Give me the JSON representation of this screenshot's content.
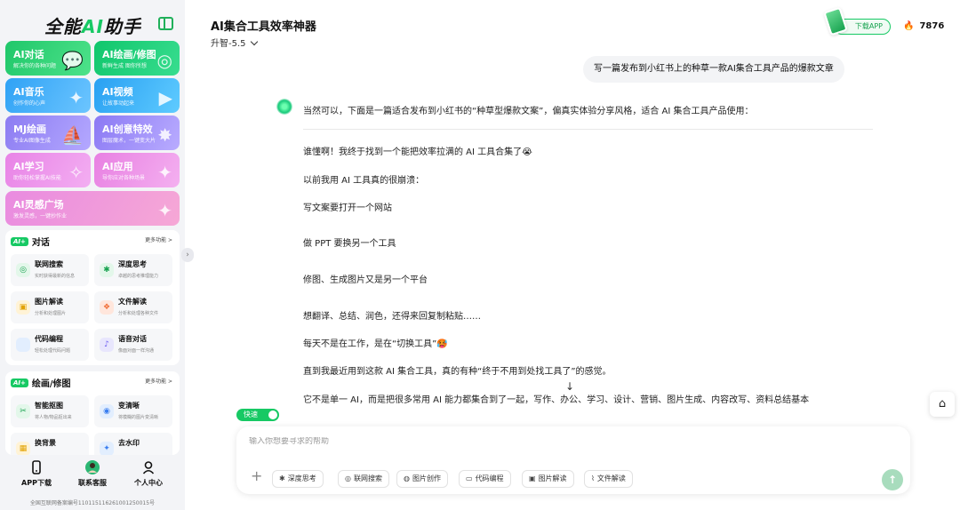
{
  "sidebar": {
    "logo_text_a": "全能",
    "logo_text_ai": "AI",
    "logo_text_b": "助手",
    "cards": [
      {
        "title": "AI对话",
        "sub": "解决你的各种问题",
        "color": "#1fc76a",
        "color2": "#4ee28a",
        "icon": "chat-icon"
      },
      {
        "title": "AI绘画/修图",
        "sub": "新鲜生成 图你所想",
        "color": "#10c66c",
        "color2": "#38dd8f",
        "icon": "paint-icon"
      },
      {
        "title": "AI音乐",
        "sub": "创作你的心声",
        "color": "#2fa2f5",
        "color2": "#6cc5ff",
        "icon": "music-icon"
      },
      {
        "title": "AI视频",
        "sub": "让故事动起来",
        "color": "#29a0f2",
        "color2": "#5fcbff",
        "icon": "video-icon"
      },
      {
        "title": "MJ绘画",
        "sub": "专业AI图像生成",
        "color": "#8c7cf2",
        "color2": "#b4a8ff",
        "icon": "sail-icon"
      },
      {
        "title": "AI创意特效",
        "sub": "图层魔术，一键变大片",
        "color": "#8b79f4",
        "color2": "#b9acff",
        "icon": "wand-icon"
      },
      {
        "title": "AI学习",
        "sub": "助你轻松掌握AI技能",
        "color": "#e883e6",
        "color2": "#f3aef2",
        "icon": "star-icon"
      },
      {
        "title": "AI应用",
        "sub": "导你应对各种场景",
        "color": "#e880e2",
        "color2": "#f4b0f0",
        "icon": "grid-icon"
      },
      {
        "title": "AI灵感广场",
        "sub": "激发灵感，一键抄作业",
        "color": "#e98be0",
        "color2": "#f6a8d6",
        "icon": "sparkle-icon"
      }
    ],
    "section_chat": {
      "badge": "AI+",
      "title": "对话",
      "more": "更多功能 >",
      "tools": [
        {
          "title": "联网搜索",
          "sub": "实时获得最新的信息",
          "bg": "#e3f7ea",
          "fg": "#17a24f",
          "glyph": "◎",
          "icon": "web-search-icon"
        },
        {
          "title": "深度思考",
          "sub": "卓越的思考推理能力",
          "bg": "#e3f7ea",
          "fg": "#17a24f",
          "glyph": "✱",
          "icon": "deep-think-icon"
        },
        {
          "title": "图片解读",
          "sub": "分析和处理图片",
          "bg": "#fff3d6",
          "fg": "#e2a200",
          "glyph": "▣",
          "icon": "image-read-icon"
        },
        {
          "title": "文件解读",
          "sub": "分析和处理各种文件",
          "bg": "#ffe6dc",
          "fg": "#f0703a",
          "glyph": "❖",
          "icon": "file-read-icon"
        },
        {
          "title": "代码编程",
          "sub": "轻松处理代码问题",
          "bg": "#e2eefe",
          "fg": "#3a7ef0",
          "glyph": "</>",
          "icon": "code-icon"
        },
        {
          "title": "语音对话",
          "sub": "像面对面一样沟通",
          "bg": "#e8e6fd",
          "fg": "#6a5af0",
          "glyph": "♪",
          "icon": "voice-icon"
        }
      ]
    },
    "section_paint": {
      "badge": "AI+",
      "title": "绘画/修图",
      "more": "更多功能 >",
      "tools": [
        {
          "title": "智能抠图",
          "sub": "将人物/物品抠出来",
          "bg": "#e3f7ea",
          "fg": "#17a24f",
          "glyph": "✂",
          "icon": "cutout-icon"
        },
        {
          "title": "变清晰",
          "sub": "将模糊的图片变清晰",
          "bg": "#e2eefe",
          "fg": "#3a7ef0",
          "glyph": "◉",
          "icon": "sharpen-icon"
        },
        {
          "title": "换背景",
          "sub": "",
          "bg": "#fff3d6",
          "fg": "#e2a200",
          "glyph": "▦",
          "icon": "background-icon"
        },
        {
          "title": "去水印",
          "sub": "",
          "bg": "#e2eefe",
          "fg": "#3a7ef0",
          "glyph": "✦",
          "icon": "watermark-icon"
        }
      ]
    },
    "bottom_nav": [
      {
        "label": "APP下载",
        "icon": "phone-icon"
      },
      {
        "label": "联系客服",
        "icon": "support-avatar-icon"
      },
      {
        "label": "个人中心",
        "icon": "user-icon"
      }
    ],
    "icp": "全国互联网备案编号110115116261001250015号",
    "collapse_glyph": "›"
  },
  "header": {
    "title": "AI集合工具效率神器",
    "model": "升智-5.5",
    "download_label": "下载APP",
    "coins": "7876",
    "flame_glyph": "🔥"
  },
  "chat": {
    "user_message": "写一篇发布到小红书上的种草一款AI集合工具产品的爆款文章",
    "reply_intro": "当然可以，下面是一篇适合发布到小红书的“种草型爆款文案”，偏真实体验分享风格，适合 AI 集合工具产品使用：",
    "paragraphs": [
      "谁懂啊！我终于找到一个能把效率拉满的 AI 工具合集了😭",
      "以前我用 AI 工具真的很崩溃：",
      "写文案要打开一个网站",
      "做 PPT 要换另一个工具",
      "修图、生成图片又是另一个平台",
      "想翻译、总结、润色，还得来回复制粘贴……",
      "每天不是在工作，是在“切换工具”🥵",
      "直到我最近用到这款 AI 集合工具，真的有种“终于不用到处找工具了”的感觉。",
      "它不是单一 AI，而是把很多常用 AI 能力都集合到了一起，写作、办公、学习、设计、营销、图片生成、内容改写、资料总结基本"
    ],
    "scroll_glyph": "↓",
    "side_glyph": "⌂"
  },
  "composer": {
    "fast_label": "快速",
    "placeholder": "输入你想要寻求的帮助",
    "plus_glyph": "+",
    "send_glyph": "↑",
    "chips": [
      {
        "label": "深度思考",
        "glyph": "✱",
        "icon": "deep-think-icon"
      },
      {
        "label": "联网搜索",
        "glyph": "◎",
        "icon": "globe-icon"
      },
      {
        "label": "图片创作",
        "glyph": "◍",
        "icon": "image-create-icon"
      },
      {
        "label": "代码编程",
        "glyph": "▭",
        "icon": "code-icon"
      },
      {
        "label": "图片解读",
        "glyph": "▣",
        "icon": "image-read-icon"
      },
      {
        "label": "文件解读",
        "glyph": "⌇",
        "icon": "attach-icon"
      }
    ]
  }
}
